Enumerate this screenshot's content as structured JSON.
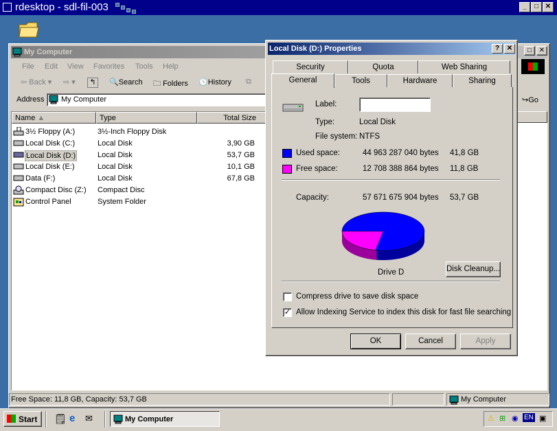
{
  "rdesktop": {
    "title": "rdesktop - sdl-fil-003"
  },
  "desktop": {
    "icon": "folder-icon"
  },
  "window": {
    "title": "My Computer",
    "menu": [
      "File",
      "Edit",
      "View",
      "Favorites",
      "Tools",
      "Help"
    ],
    "toolbar": {
      "back": "Back",
      "search": "Search",
      "folders": "Folders",
      "history": "History",
      "go": "Go"
    },
    "address_label": "Address",
    "address_value": "My Computer",
    "columns": [
      "Name",
      "Type",
      "Total Size"
    ],
    "items": [
      {
        "name": "3½ Floppy (A:)",
        "type": "3½-Inch Floppy Disk",
        "size": ""
      },
      {
        "name": "Local Disk (C:)",
        "type": "Local Disk",
        "size": "3,90 GB"
      },
      {
        "name": "Local Disk (D:)",
        "type": "Local Disk",
        "size": "53,7 GB"
      },
      {
        "name": "Local Disk (E:)",
        "type": "Local Disk",
        "size": "10,1 GB"
      },
      {
        "name": "Data (F:)",
        "type": "Local Disk",
        "size": "67,8 GB"
      },
      {
        "name": "Compact Disc (Z:)",
        "type": "Compact Disc",
        "size": ""
      },
      {
        "name": "Control Panel",
        "type": "System Folder",
        "size": ""
      }
    ],
    "status_left": "Free Space: 11,8 GB, Capacity: 53,7 GB",
    "status_right": "My Computer"
  },
  "dialog": {
    "title": "Local Disk (D:) Properties",
    "help_btn": "?",
    "close_btn": "✕",
    "tabs_back": [
      "Security",
      "Quota",
      "Web Sharing"
    ],
    "tabs_front": [
      "General",
      "Tools",
      "Hardware",
      "Sharing"
    ],
    "label_label": "Label:",
    "label_value": "",
    "type_label": "Type:",
    "type_value": "Local Disk",
    "fs_label": "File system:",
    "fs_value": "NTFS",
    "used_label": "Used space:",
    "used_bytes": "44 963 287 040 bytes",
    "used_gb": "41,8 GB",
    "free_label": "Free space:",
    "free_bytes": "12 708 388 864 bytes",
    "free_gb": "11,8 GB",
    "capacity_label": "Capacity:",
    "capacity_bytes": "57 671 675 904 bytes",
    "capacity_gb": "53,7 GB",
    "drive_label": "Drive D",
    "cleanup_btn": "Disk Cleanup...",
    "compress_label": "Compress drive to save disk space",
    "compress_checked": false,
    "index_label": "Allow Indexing Service to index this disk for fast file searching",
    "index_checked": true,
    "ok": "OK",
    "cancel": "Cancel",
    "apply": "Apply",
    "colors": {
      "used": "#0000ff",
      "free": "#ff00ff"
    },
    "used_fraction": 0.78
  },
  "taskbar": {
    "start": "Start",
    "task": "My Computer",
    "tray_lang": "EN"
  }
}
